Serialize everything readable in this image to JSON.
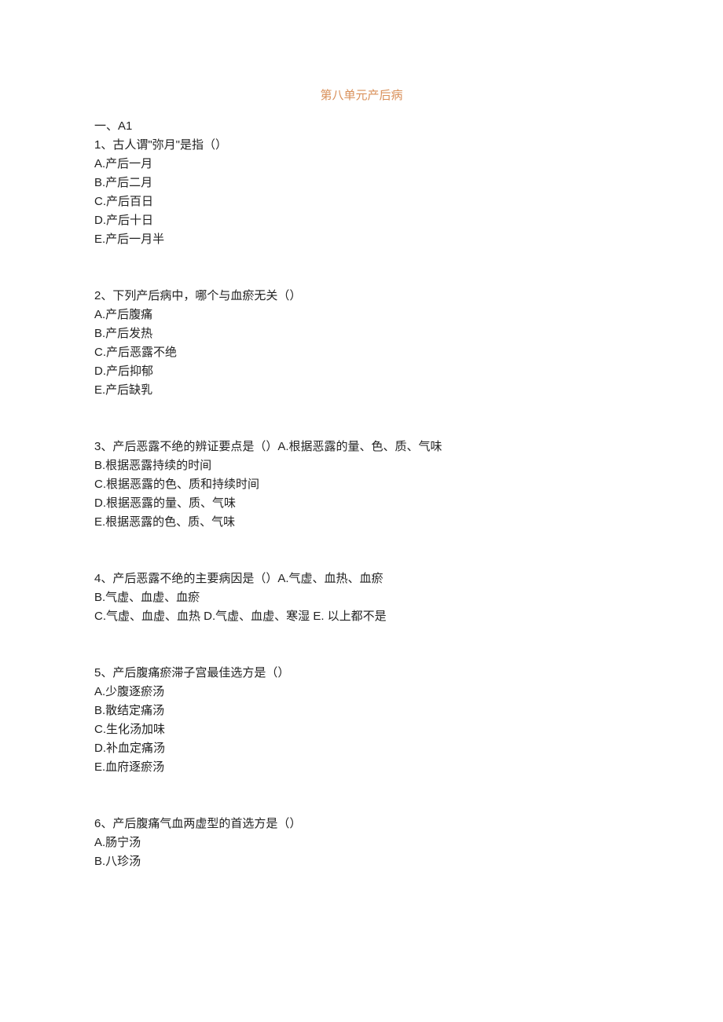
{
  "title": "第八单元产后病",
  "section_header": "一、A1",
  "questions": [
    {
      "stem": "1、古人谓\"弥月\"是指（）",
      "options": [
        "A.产后一月",
        "B.产后二月",
        "C.产后百日",
        "D.产后十日",
        "E.产后一月半"
      ]
    },
    {
      "stem": "2、下列产后病中，哪个与血瘀无关（）",
      "options": [
        "A.产后腹痛",
        "B.产后发热",
        "C.产后恶露不绝",
        "D.产后抑郁",
        "E.产后缺乳"
      ]
    },
    {
      "stem": "3、产后恶露不绝的辨证要点是（）A.根据恶露的量、色、质、气味",
      "options": [
        "B.根据恶露持续的时间",
        "C.根据恶露的色、质和持续时间",
        "D.根据恶露的量、质、气味",
        "E.根据恶露的色、质、气味"
      ]
    },
    {
      "stem": "4、产后恶露不绝的主要病因是（）A.气虚、血热、血瘀",
      "options": [
        "B.气虚、血虚、血瘀",
        "C.气虚、血虚、血热 D.气虚、血虚、寒湿 E. 以上都不是"
      ]
    },
    {
      "stem": "5、产后腹痛瘀滞子宫最佳选方是（）",
      "options": [
        "A.少腹逐瘀汤",
        "B.散结定痛汤",
        "C.生化汤加味",
        "D.补血定痛汤",
        "E.血府逐瘀汤"
      ]
    },
    {
      "stem": "6、产后腹痛气血两虚型的首选方是（）",
      "options": [
        "A.肠宁汤",
        "B.八珍汤"
      ]
    }
  ]
}
